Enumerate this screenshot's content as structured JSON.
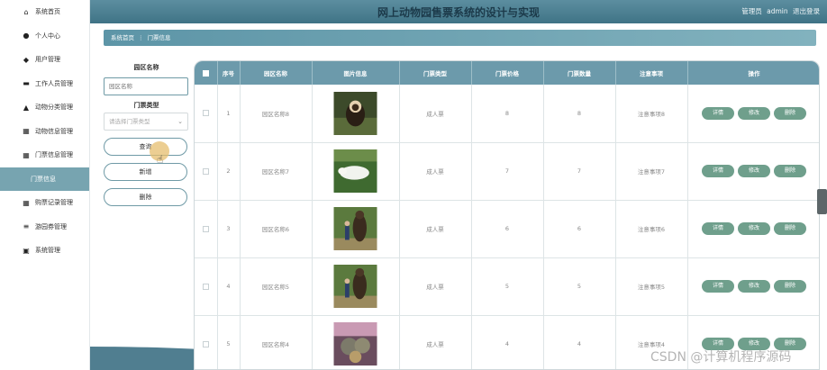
{
  "header": {
    "title": "网上动物园售票系统的设计与实现",
    "role": "管理员",
    "username": "admin",
    "logout_label": "退出登录"
  },
  "sidebar": {
    "items": [
      {
        "label": "系统首页",
        "icon": "home-icon",
        "glyph": "⌂",
        "active": false
      },
      {
        "label": "个人中心",
        "icon": "person-icon",
        "glyph": "●",
        "active": false
      },
      {
        "label": "用户管理",
        "icon": "pin-icon",
        "glyph": "◆",
        "active": false
      },
      {
        "label": "工作人员管理",
        "icon": "keyboard-icon",
        "glyph": "▬",
        "active": false
      },
      {
        "label": "动物分类管理",
        "icon": "thumb-icon",
        "glyph": "▲",
        "active": false
      },
      {
        "label": "动物信息管理",
        "icon": "grid-icon",
        "glyph": "▦",
        "active": false
      },
      {
        "label": "门票信息管理",
        "icon": "grid-icon",
        "glyph": "▦",
        "active": false
      },
      {
        "label": "门票信息",
        "icon": "",
        "glyph": "",
        "active": true
      },
      {
        "label": "购票记录管理",
        "icon": "grid-icon",
        "glyph": "▦",
        "active": false
      },
      {
        "label": "游园券管理",
        "icon": "menu-icon",
        "glyph": "≡",
        "active": false
      },
      {
        "label": "系统管理",
        "icon": "clipboard-icon",
        "glyph": "▣",
        "active": false
      }
    ]
  },
  "breadcrumb": {
    "home": "系统首页",
    "separator": "⋮",
    "current": "门票信息"
  },
  "search": {
    "zone_label": "园区名称",
    "zone_placeholder": "园区名称",
    "type_label": "门票类型",
    "type_placeholder": "请选择门票类型",
    "query_label": "查询",
    "add_label": "新增",
    "delete_label": "删除"
  },
  "table": {
    "columns": [
      "",
      "序号",
      "园区名称",
      "图片信息",
      "门票类型",
      "门票价格",
      "门票数量",
      "注意事项",
      "操作"
    ],
    "rows": [
      {
        "index": "1",
        "zone": "园区名称8",
        "ticket_type": "成人票",
        "price": "8",
        "quantity": "8",
        "note": "注意事项8",
        "image": "capuchin monkey"
      },
      {
        "index": "2",
        "zone": "园区名称7",
        "ticket_type": "成人票",
        "price": "7",
        "quantity": "7",
        "note": "注意事项7",
        "image": "white beluga whale"
      },
      {
        "index": "3",
        "zone": "园区名称6",
        "ticket_type": "成人票",
        "price": "6",
        "quantity": "6",
        "note": "注意事项6",
        "image": "bear standing with person"
      },
      {
        "index": "4",
        "zone": "园区名称5",
        "ticket_type": "成人票",
        "price": "5",
        "quantity": "5",
        "note": "注意事项5",
        "image": "bear standing with person"
      },
      {
        "index": "5",
        "zone": "园区名称4",
        "ticket_type": "成人票",
        "price": "4",
        "quantity": "4",
        "note": "注意事项4",
        "image": "group of animals"
      }
    ],
    "actions": {
      "detail": "详情",
      "edit": "修改",
      "delete": "删除"
    }
  },
  "watermark": "CSDN @计算机程序源码",
  "colors": {
    "header_bg": "#4a7f92",
    "sidebar_active": "#77a4b0",
    "table_header": "#6c9aab",
    "action_button": "#6f9f8c"
  }
}
